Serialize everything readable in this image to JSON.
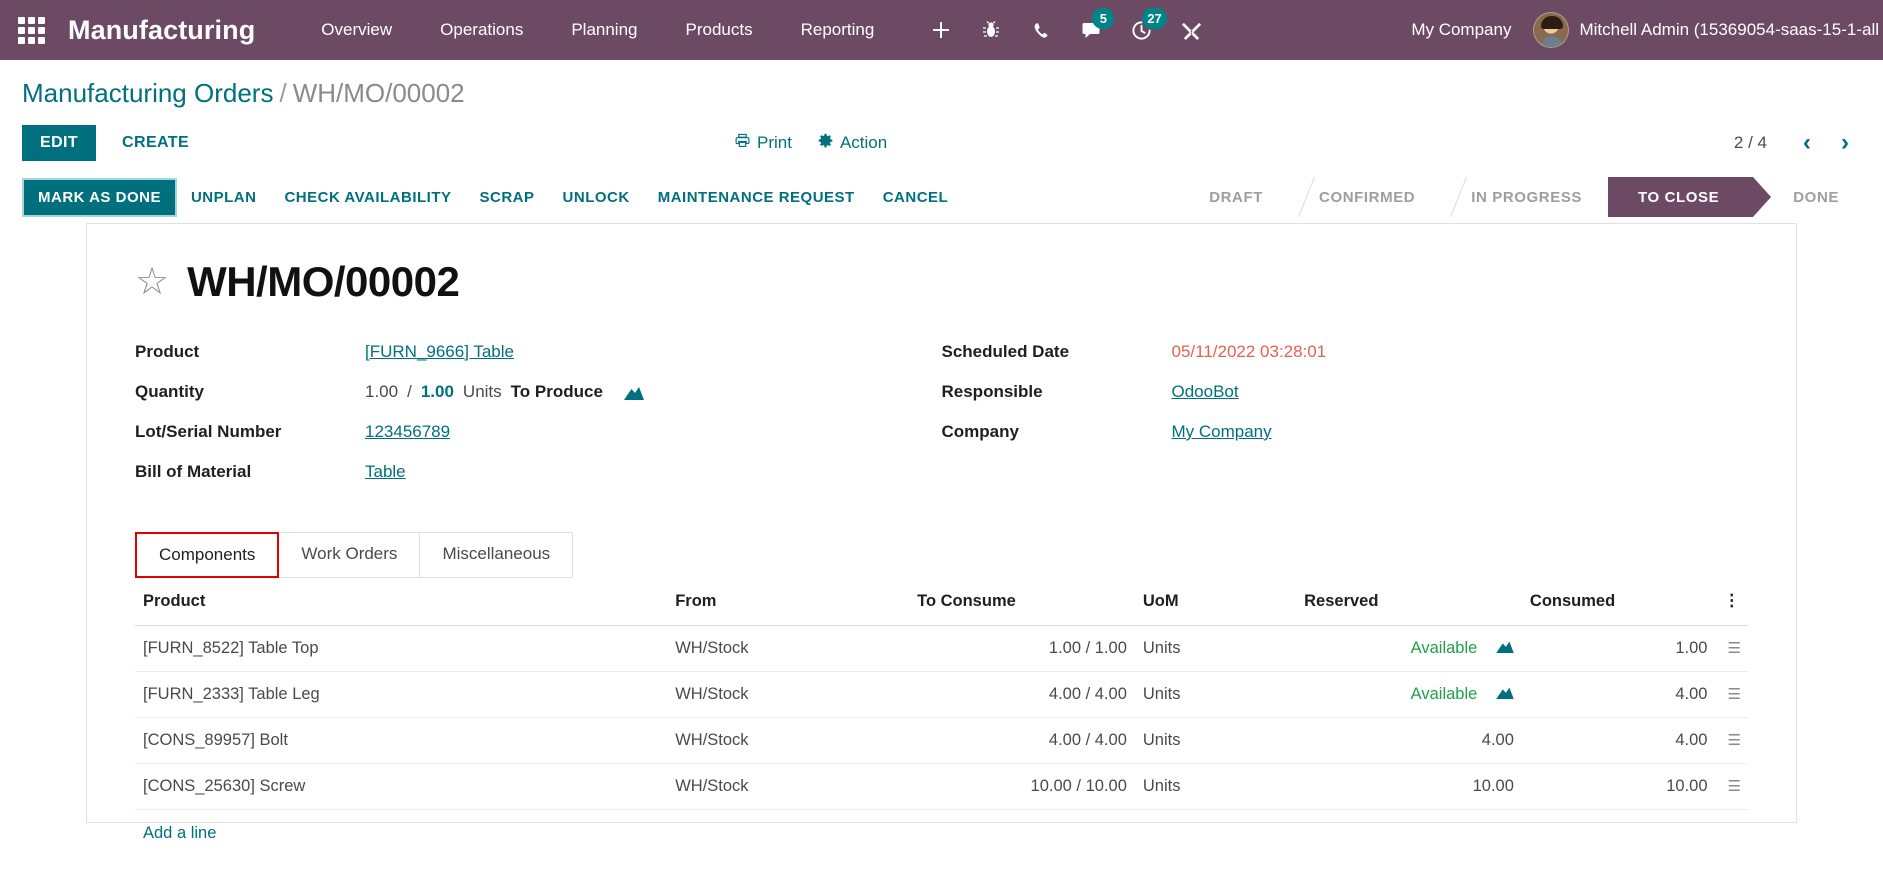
{
  "navbar": {
    "apps_icon": "apps-grid-icon",
    "brand": "Manufacturing",
    "menu": [
      {
        "label": "Overview"
      },
      {
        "label": "Operations"
      },
      {
        "label": "Planning"
      },
      {
        "label": "Products"
      },
      {
        "label": "Reporting"
      }
    ],
    "icons": [
      {
        "name": "plus-icon",
        "glyph": "+",
        "badge": ""
      },
      {
        "name": "bug-icon",
        "glyph": "🐞",
        "badge": ""
      },
      {
        "name": "phone-icon",
        "glyph": "☎",
        "badge": ""
      },
      {
        "name": "messages-icon",
        "glyph": "💬",
        "badge": "5"
      },
      {
        "name": "activities-clock-icon",
        "glyph": "◔",
        "badge": "27"
      },
      {
        "name": "tools-icon",
        "glyph": "⚒",
        "badge": ""
      }
    ],
    "company": "My Company",
    "user": "Mitchell Admin (15369054-saas-15-1-all",
    "accent_bg": "#6d4a63",
    "badge_color": "#00848b"
  },
  "breadcrumb": {
    "root": "Manufacturing Orders",
    "separator": "/",
    "current": "WH/MO/00002"
  },
  "control_bar": {
    "edit_label": "EDIT",
    "create_label": "CREATE",
    "print_label": "Print",
    "print_icon": "printer-icon",
    "action_label": "Action",
    "action_icon": "gear-icon",
    "pager_count": "2 / 4",
    "prev_icon": "chevron-left-icon",
    "next_icon": "chevron-right-icon"
  },
  "statusbar": {
    "buttons": [
      {
        "label": "MARK AS DONE",
        "primary": true
      },
      {
        "label": "UNPLAN",
        "primary": false
      },
      {
        "label": "CHECK AVAILABILITY",
        "primary": false
      },
      {
        "label": "SCRAP",
        "primary": false
      },
      {
        "label": "UNLOCK",
        "primary": false
      },
      {
        "label": "MAINTENANCE REQUEST",
        "primary": false
      },
      {
        "label": "CANCEL",
        "primary": false
      }
    ],
    "stages": [
      {
        "label": "DRAFT",
        "active": false
      },
      {
        "label": "CONFIRMED",
        "active": false
      },
      {
        "label": "IN PROGRESS",
        "active": false
      },
      {
        "label": "TO CLOSE",
        "active": true
      },
      {
        "label": "DONE",
        "active": false
      }
    ],
    "active_stage_color": "#6d4a63"
  },
  "form": {
    "star_icon": "favorite-star-icon",
    "title": "WH/MO/00002",
    "left": {
      "product_label": "Product",
      "product_value": "[FURN_9666] Table",
      "quantity_label": "Quantity",
      "quantity_done": "1.00",
      "quantity_sep": "/",
      "quantity_total": "1.00",
      "quantity_uom": "Units",
      "quantity_suffix": "To Produce",
      "quantity_chart_icon": "bar-chart-icon",
      "lot_label": "Lot/Serial Number",
      "lot_value": "123456789",
      "bom_label": "Bill of Material",
      "bom_value": "Table"
    },
    "right": {
      "scheduled_label": "Scheduled Date",
      "scheduled_value": "05/11/2022 03:28:01",
      "scheduled_color": "#e8604c",
      "responsible_label": "Responsible",
      "responsible_value": "OdooBot",
      "company_label": "Company",
      "company_value": "My Company"
    }
  },
  "tabs": [
    {
      "label": "Components",
      "active": true
    },
    {
      "label": "Work Orders",
      "active": false
    },
    {
      "label": "Miscellaneous",
      "active": false
    }
  ],
  "table": {
    "headers": [
      "Product",
      "From",
      "To Consume",
      "UoM",
      "Reserved",
      "Consumed"
    ],
    "options_icon": "table-options-icon",
    "rows": [
      {
        "product": "[FURN_8522] Table Top",
        "from": "WH/Stock",
        "to_consume": "1.00 / 1.00",
        "uom": "Units",
        "reserved": "Available",
        "reserved_available": true,
        "reserved_chart_icon": "bar-chart-icon",
        "consumed": "1.00",
        "row_icon": "list-lines-icon"
      },
      {
        "product": "[FURN_2333] Table Leg",
        "from": "WH/Stock",
        "to_consume": "4.00 / 4.00",
        "uom": "Units",
        "reserved": "Available",
        "reserved_available": true,
        "reserved_chart_icon": "bar-chart-icon",
        "consumed": "4.00",
        "row_icon": "list-lines-icon"
      },
      {
        "product": "[CONS_89957] Bolt",
        "from": "WH/Stock",
        "to_consume": "4.00 / 4.00",
        "uom": "Units",
        "reserved": "4.00",
        "reserved_available": false,
        "reserved_chart_icon": "",
        "consumed": "4.00",
        "row_icon": "list-lines-icon"
      },
      {
        "product": "[CONS_25630] Screw",
        "from": "WH/Stock",
        "to_consume": "10.00 / 10.00",
        "uom": "Units",
        "reserved": "10.00",
        "reserved_available": false,
        "reserved_chart_icon": "",
        "consumed": "10.00",
        "row_icon": "list-lines-icon"
      }
    ],
    "add_line_label": "Add a line"
  }
}
